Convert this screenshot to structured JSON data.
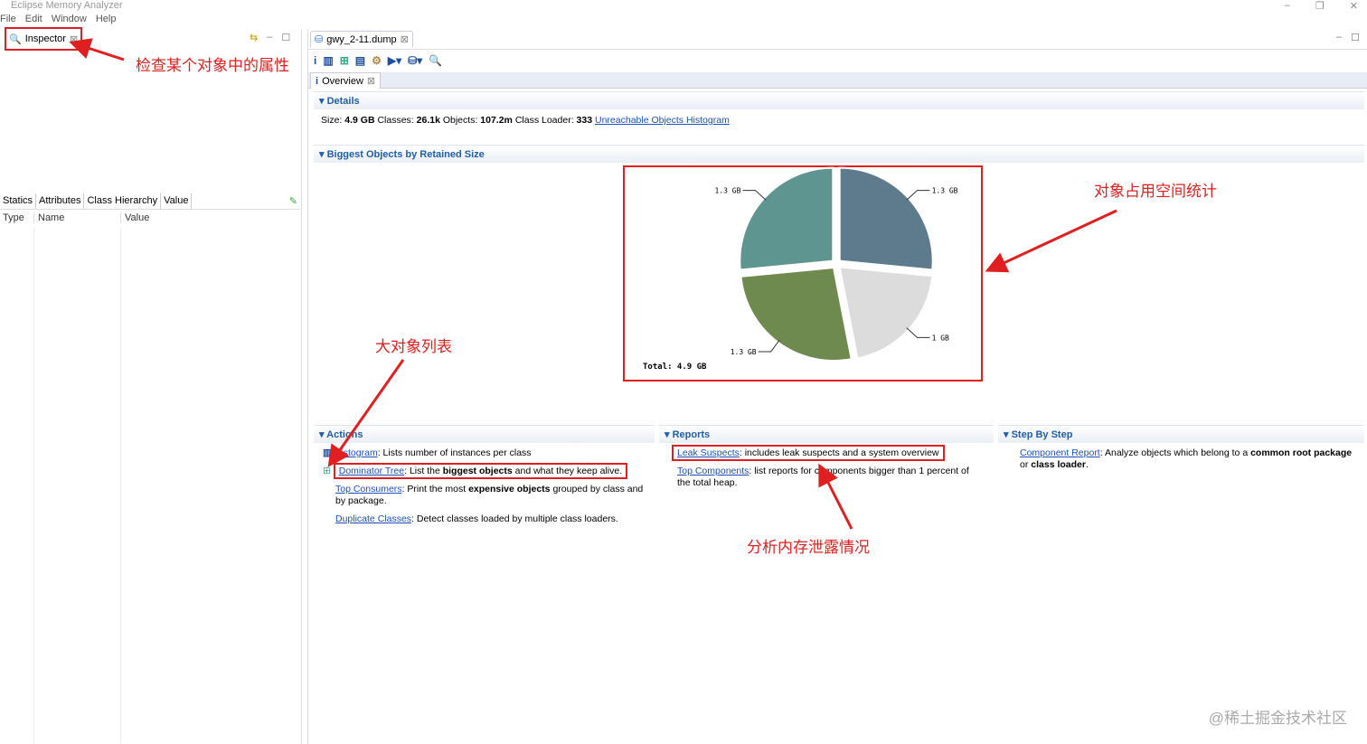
{
  "app": {
    "title": "Eclipse Memory Analyzer",
    "menu": [
      "File",
      "Edit",
      "Window",
      "Help"
    ]
  },
  "inspector": {
    "tab": "Inspector",
    "subtabs": [
      "Statics",
      "Attributes",
      "Class Hierarchy",
      "Value"
    ],
    "columns": [
      "Type",
      "Name",
      "Value"
    ]
  },
  "editor": {
    "tab": "gwy_2-11.dump",
    "overview_tab": "Overview"
  },
  "details": {
    "title": "Details",
    "size_label": "Size:",
    "size": "4.9 GB",
    "classes_label": "Classes:",
    "classes": "26.1k",
    "objects_label": "Objects:",
    "objects": "107.2m",
    "loader_label": "Class Loader:",
    "loader": "333",
    "link": "Unreachable Objects Histogram"
  },
  "biggest": {
    "title": "Biggest Objects by Retained Size"
  },
  "chart_data": {
    "type": "pie",
    "unit": "GB",
    "values": [
      1.3,
      1.0,
      1.3,
      1.3
    ],
    "labels": [
      "1.3 GB",
      "1 GB",
      "1.3 GB",
      "1.3 GB"
    ],
    "colors": [
      "#5e7b8e",
      "#dcdcdc",
      "#6f8a4e",
      "#5f9590"
    ],
    "total": "Total: 4.9 GB"
  },
  "actions": {
    "title": "Actions",
    "items": [
      {
        "link": "Histogram",
        "t1": ": Lists number of instances per class",
        "b": "",
        "t2": ""
      },
      {
        "link": "Dominator Tree",
        "t1": ": List the ",
        "b": "biggest objects",
        "t2": " and what they keep alive."
      },
      {
        "link": "Top Consumers",
        "t1": ": Print the most ",
        "b": "expensive objects",
        "t2": " grouped by class and by package."
      },
      {
        "link": "Duplicate Classes",
        "t1": ": Detect classes loaded by multiple class loaders.",
        "b": "",
        "t2": ""
      }
    ]
  },
  "reports": {
    "title": "Reports",
    "items": [
      {
        "link": "Leak Suspects",
        "t1": ": includes leak suspects and a system overview"
      },
      {
        "link": "Top Components",
        "t1": ": list reports for components bigger than 1 percent of the total heap."
      }
    ]
  },
  "step": {
    "title": "Step By Step",
    "link": "Component Report",
    "t1": ": Analyze objects which belong to a ",
    "b1": "common root package",
    "t2": " or ",
    "b2": "class loader",
    "t3": "."
  },
  "annotations": {
    "inspector": "检查某个对象中的属性",
    "chart": "对象占用空间统计",
    "dominator": "大对象列表",
    "leak": "分析内存泄露情况"
  },
  "watermark": "@稀土掘金技术社区"
}
